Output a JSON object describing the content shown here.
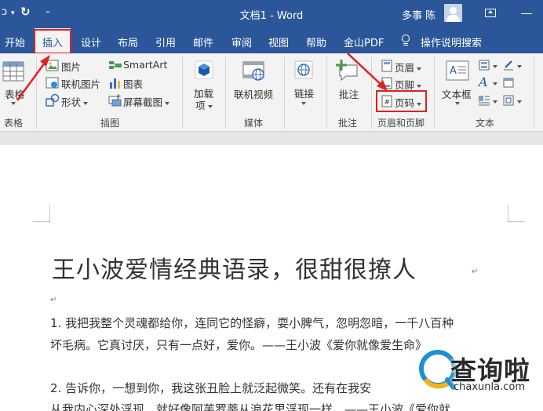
{
  "window": {
    "title": "文档1 - Word",
    "user": "多事 陈",
    "quick_access": {
      "undo_glyph": "ɔ",
      "redo_glyph": "↻",
      "customize_glyph": "⁼"
    }
  },
  "tabs": {
    "file": "开始",
    "insert": "插入",
    "design": "设计",
    "layout": "布局",
    "references": "引用",
    "mailings": "邮件",
    "review": "审阅",
    "view": "视图",
    "help": "帮助",
    "pdf": "金山PDF",
    "search": "操作说明搜索"
  },
  "ribbon": {
    "tables": {
      "button": "表格",
      "label": "表格"
    },
    "illustrations": {
      "pictures": "图片",
      "online_pictures": "联机图片",
      "shapes": "形状",
      "smartart": "SmartArt",
      "chart": "图表",
      "screenshot": "屏幕截图",
      "label": "插图"
    },
    "addins": {
      "button_line1": "加载",
      "button_line2": "项"
    },
    "media": {
      "button": "联机视频",
      "label": "媒体"
    },
    "links": {
      "button": "链接"
    },
    "comments": {
      "button": "批注",
      "label": "批注"
    },
    "header_footer": {
      "header": "页眉",
      "footer": "页脚",
      "page_number": "页码",
      "label": "页眉和页脚"
    },
    "text": {
      "textbox": "文本框",
      "label": "文本"
    }
  },
  "document": {
    "title": "王小波爱情经典语录，很甜很撩人",
    "paragraph_mark": "↵",
    "lines": [
      "1. 我把我整个灵魂都给你，连同它的怪癖，耍小脾气，忽明忽暗，一千八百种",
      "坏毛病。它真讨厌，只有一点好，爱你。——王小波《爱你就像爱生命》",
      "2. 告诉你，一想到你，我这张丑脸上就泛起微笑。还有在我安",
      "从我内心深处浮现，就好像阿芙罗蒂从浪花里浮现一样。——王小波《爱你就"
    ]
  },
  "watermark": {
    "text": "查询啦",
    "url": "chaxunla.com"
  },
  "colors": {
    "accent": "#2b579a",
    "highlight": "#e02020",
    "ribbon_bg": "#f3f3f3"
  }
}
